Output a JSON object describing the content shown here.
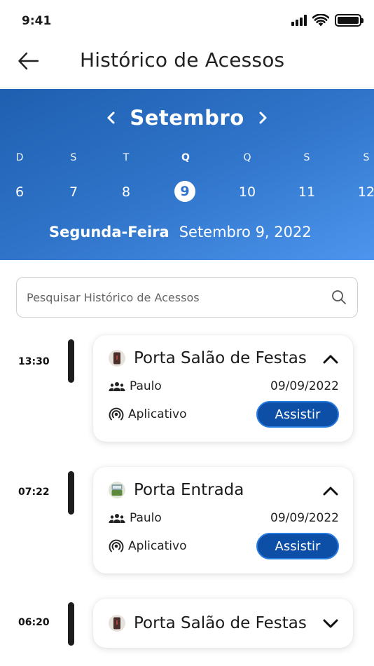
{
  "status_bar": {
    "time": "9:41"
  },
  "header": {
    "title": "Histórico de Acessos"
  },
  "calendar": {
    "month": "Setembro",
    "weekdays": [
      "D",
      "S",
      "T",
      "Q",
      "Q",
      "S",
      "S"
    ],
    "days": [
      "6",
      "7",
      "8",
      "9",
      "10",
      "11",
      "12"
    ],
    "selected_index": 3,
    "selected_weekday": "Segunda-Feira",
    "selected_full_date": "Setembro 9, 2022",
    "gradient_start": "#1f5fb0",
    "gradient_end": "#4d95ee"
  },
  "search": {
    "placeholder": "Pesquisar Histórico de Acessos",
    "value": ""
  },
  "entries": [
    {
      "time": "13:30",
      "door": "Porta Salão de Festas",
      "door_icon": "door-salao-icon",
      "expanded": true,
      "user": "Paulo",
      "date": "09/09/2022",
      "source": "Aplicativo",
      "action_label": "Assistir"
    },
    {
      "time": "07:22",
      "door": "Porta Entrada",
      "door_icon": "door-entrada-icon",
      "expanded": true,
      "user": "Paulo",
      "date": "09/09/2022",
      "source": "Aplicativo",
      "action_label": "Assistir"
    },
    {
      "time": "06:20",
      "door": "Porta Salão de Festas",
      "door_icon": "door-salao-icon",
      "expanded": false
    }
  ],
  "colors": {
    "accent": "#0d4ea6",
    "accent_border": "#2a7de0",
    "timeline_bar": "#1d1d1d"
  }
}
